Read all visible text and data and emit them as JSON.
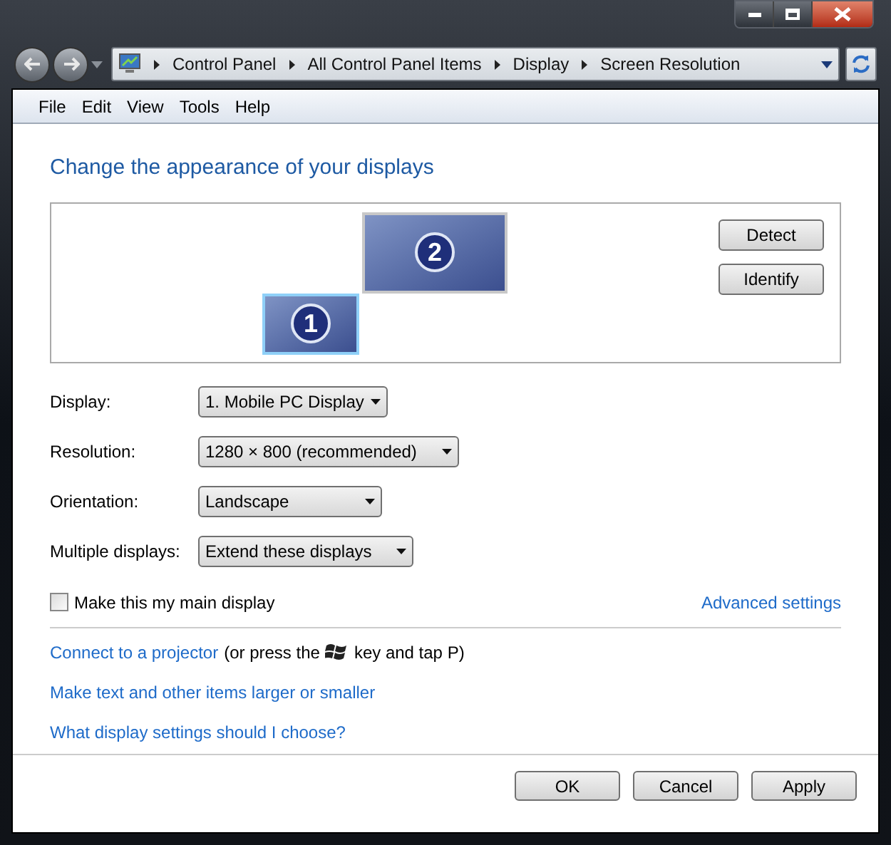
{
  "address_bar": {
    "path": [
      "Control Panel",
      "All Control Panel Items",
      "Display",
      "Screen Resolution"
    ]
  },
  "menu": [
    "File",
    "Edit",
    "View",
    "Tools",
    "Help"
  ],
  "heading": "Change the appearance of your displays",
  "monitors": [
    {
      "label": "1",
      "selected": true
    },
    {
      "label": "2",
      "selected": false
    }
  ],
  "preview_buttons": [
    "Detect",
    "Identify"
  ],
  "settings": [
    {
      "label": "Display:",
      "value": "1. Mobile PC Display"
    },
    {
      "label": "Resolution:",
      "value": "1280 × 800 (recommended)"
    },
    {
      "label": "Orientation:",
      "value": "Landscape"
    },
    {
      "label": "Multiple displays:",
      "value": "Extend these displays"
    }
  ],
  "main_display": {
    "label": "Make this my main display",
    "checked": false
  },
  "advanced_link": "Advanced settings",
  "projector": {
    "link": "Connect to a projector",
    "before_key": "(or press the",
    "after_key": "key and tap P)"
  },
  "links": [
    "Make text and other items larger or smaller",
    "What display settings should I choose?"
  ],
  "buttons": [
    "OK",
    "Cancel",
    "Apply"
  ]
}
